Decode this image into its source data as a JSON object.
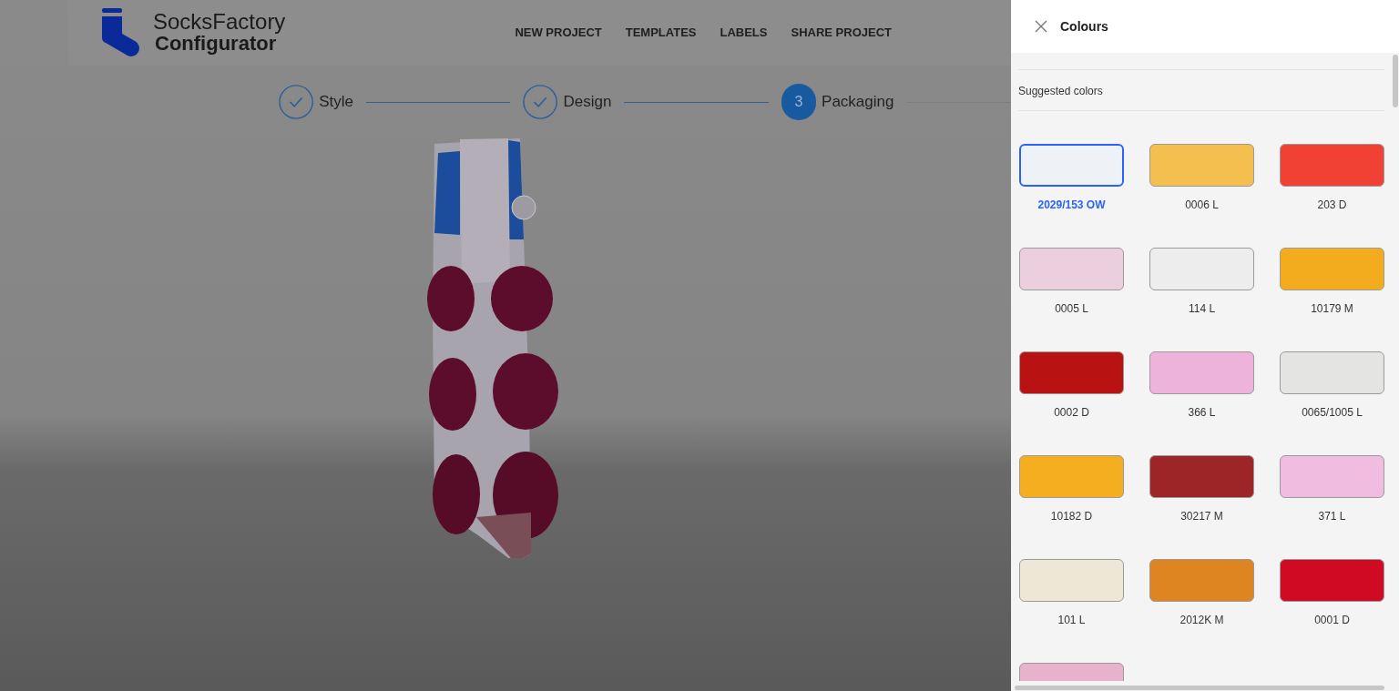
{
  "logo": {
    "line_1": "SocksFactory",
    "line_2": "Configurator"
  },
  "nav": [
    "NEW PROJECT",
    "TEMPLATES",
    "LABELS",
    "SHARE PROJECT"
  ],
  "steps": [
    {
      "label": "Style",
      "kind": "done"
    },
    {
      "label": "Design",
      "kind": "done"
    },
    {
      "label": "Packaging",
      "kind": "current",
      "number": "3"
    }
  ],
  "panel": {
    "title": "Colours",
    "section": "Suggested colors"
  },
  "swatches": [
    {
      "label": "2029/153 OW",
      "color": "#eef2f6",
      "selected": true
    },
    {
      "label": "0006 L",
      "color": "#f5bf4f",
      "selected": false
    },
    {
      "label": "203 D",
      "color": "#f04134",
      "selected": false
    },
    {
      "label": "0005 L",
      "color": "#ebcfdf",
      "selected": false
    },
    {
      "label": "114 L",
      "color": "#ededed",
      "selected": false
    },
    {
      "label": "10179 M",
      "color": "#f2ac1e",
      "selected": false
    },
    {
      "label": "0002 D",
      "color": "#b81212",
      "selected": false
    },
    {
      "label": "366 L",
      "color": "#eeb3da",
      "selected": false
    },
    {
      "label": "0065/1005 L",
      "color": "#e4e4e2",
      "selected": false
    },
    {
      "label": "10182 D",
      "color": "#f4ae1f",
      "selected": false
    },
    {
      "label": "30217 M",
      "color": "#9d2427",
      "selected": false
    },
    {
      "label": "371 L",
      "color": "#f0bde0",
      "selected": false
    },
    {
      "label": "101 L",
      "color": "#efe7d6",
      "selected": false
    },
    {
      "label": "2012K M",
      "color": "#de8420",
      "selected": false
    },
    {
      "label": "0001 D",
      "color": "#d00a22",
      "selected": false
    },
    {
      "color": "#e9b2cc",
      "selected": false
    }
  ]
}
